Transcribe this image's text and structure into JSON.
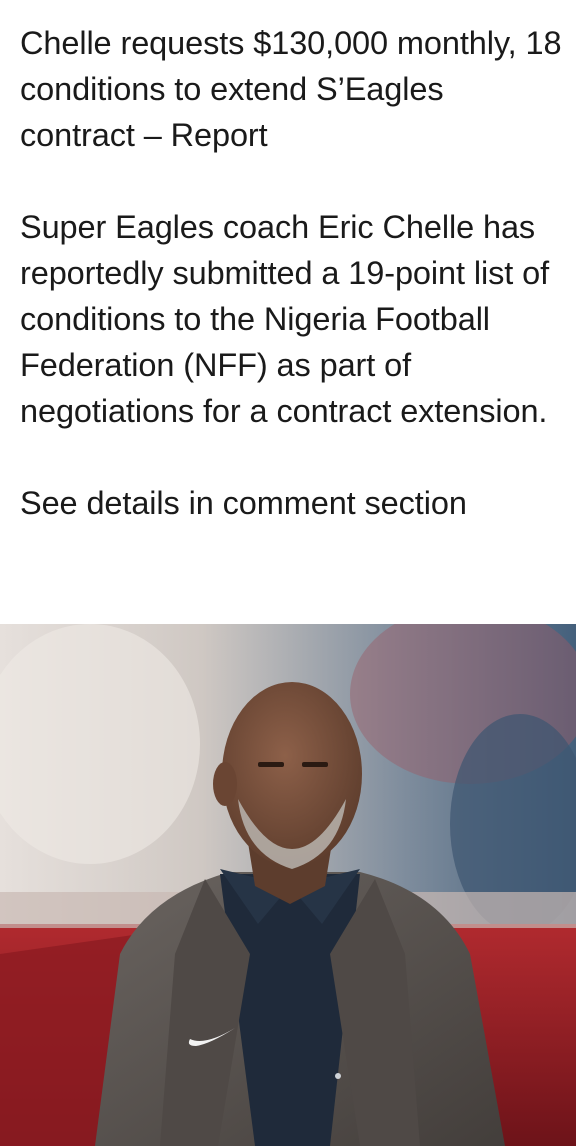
{
  "post": {
    "headline": "Chelle requests $130,000 monthly, 18 conditions to extend S’Eagles contract – Report",
    "body": "Super Eagles coach Eric Chelle has reportedly submitted a 19-point list of conditions to the Nigeria Football Federation (NFF) as part of negotiations for a contract extension.",
    "cta": "See details in comment section"
  },
  "photo": {
    "icon": "portrait-photo-icon",
    "colors": {
      "background_light": "#d8d3cf",
      "background_stadium": "#8c1d24",
      "background_blue": "#4d6a86",
      "jacket": "#5b5552",
      "shirt": "#1f2a3a",
      "skin": "#7a5340",
      "beard": "#b9b4ae"
    }
  }
}
